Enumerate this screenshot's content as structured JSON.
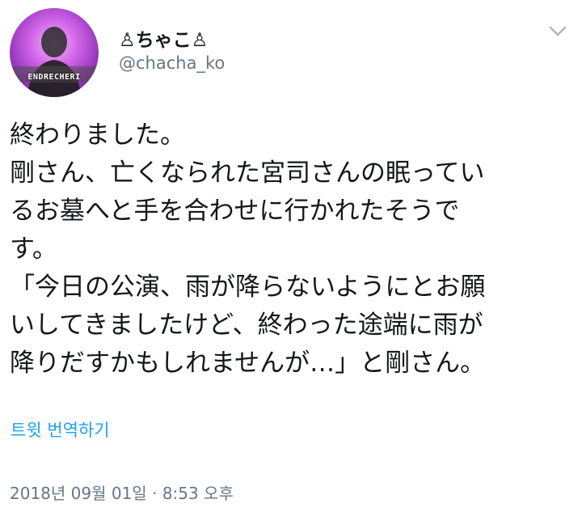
{
  "tweet": {
    "display_name": "♙ちゃこ♙",
    "username": "@chacha_ko",
    "avatar_label": "ENDRECHERI",
    "lines": [
      "終わりました。",
      "剛さん、亡くなられた宮司さんの眠ってい",
      "るお墓へと手を合わせに行かれたそうで",
      "す。",
      "「今日の公演、雨が降らないようにとお願",
      "いしてきましたけど、終わった途端に雨が",
      "降りだすかもしれませんが…」と剛さん。"
    ],
    "translate_label": "트윗 번역하기",
    "timestamp": "2018년 09월 01일 · 8:53 오후",
    "icons": {
      "menu": "chevron-down-icon"
    },
    "colors": {
      "link": "#1da1f2",
      "secondary_text": "#657786",
      "primary_text": "#14171a"
    }
  }
}
